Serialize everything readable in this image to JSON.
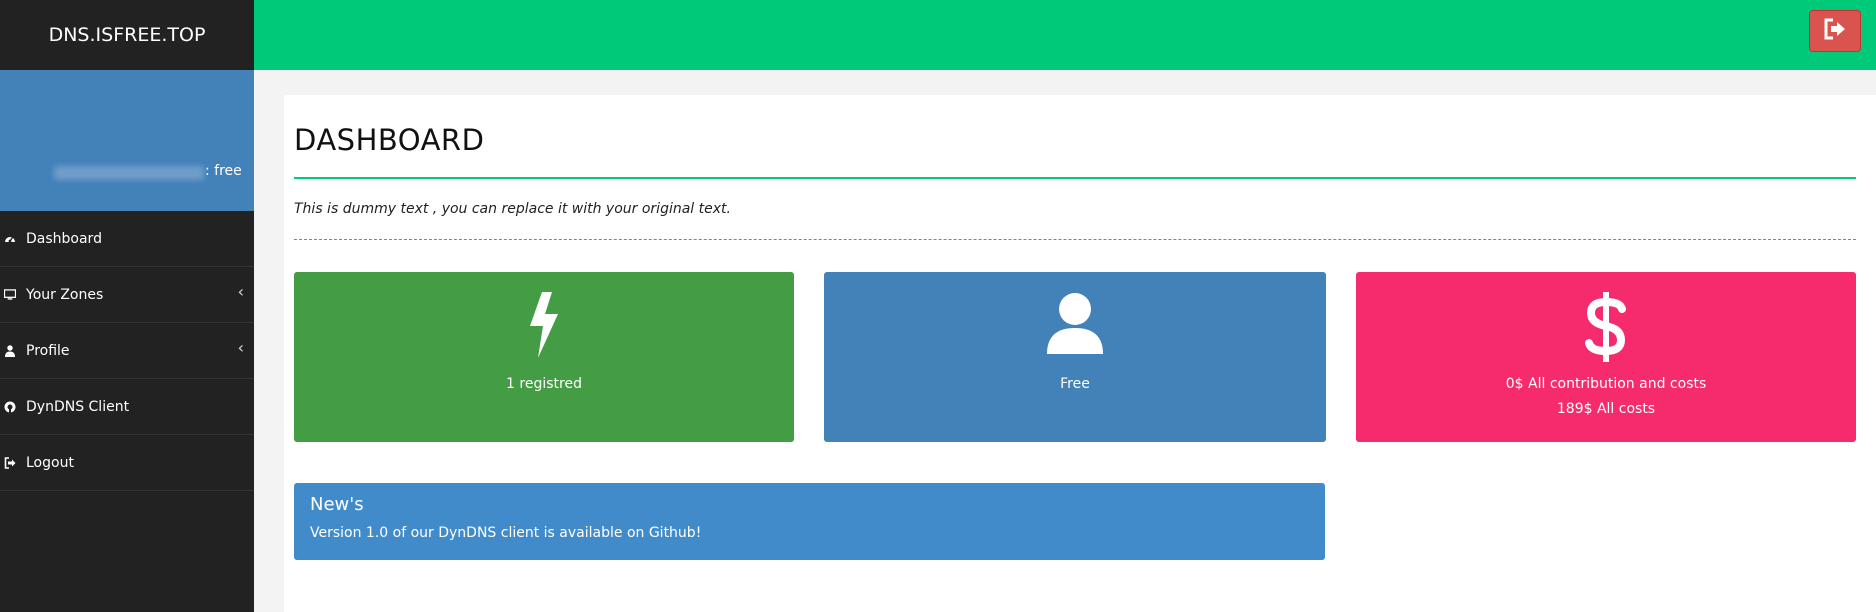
{
  "app": {
    "brand": "DNS.ISFREE.TOP"
  },
  "user": {
    "plan_label": ": free"
  },
  "sidebar": {
    "items": [
      {
        "label": "Dashboard",
        "icon": "dashboard-icon",
        "has_submenu": false
      },
      {
        "label": "Your Zones",
        "icon": "desktop-icon",
        "has_submenu": true
      },
      {
        "label": "Profile",
        "icon": "user-icon",
        "has_submenu": true
      },
      {
        "label": "DynDNS Client",
        "icon": "github-icon",
        "has_submenu": false
      },
      {
        "label": "Logout",
        "icon": "sign-out-icon",
        "has_submenu": false
      }
    ]
  },
  "header": {
    "logout_icon": "sign-out-icon"
  },
  "main": {
    "title": "DASHBOARD",
    "description": "This is dummy text , you can replace it with your original text.",
    "stats": [
      {
        "icon": "bolt-icon",
        "line1": "1 registred",
        "line2": "",
        "color": "#449d44"
      },
      {
        "icon": "user-icon",
        "line1": "Free",
        "line2": "",
        "color": "#4381b9"
      },
      {
        "icon": "dollar-icon",
        "line1": "0$ All contribution and costs",
        "line2": "189$ All costs",
        "color": "#f52b6e"
      }
    ],
    "news": {
      "title": "New's",
      "body": "Version 1.0 of our DynDNS client is available on Github!"
    }
  },
  "colors": {
    "topbar": "#00c97a",
    "sidebar": "#222222",
    "user_panel": "#4381b9",
    "logout_button": "#d9534f",
    "news": "#428bca"
  }
}
